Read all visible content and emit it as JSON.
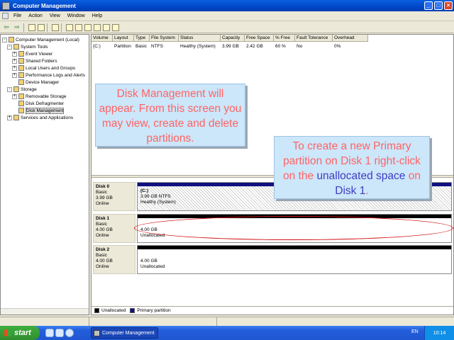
{
  "window": {
    "title": "Computer Management"
  },
  "menu": [
    "File",
    "Action",
    "View",
    "Window",
    "Help"
  ],
  "tree": [
    {
      "label": "Computer Management (Local)",
      "level": 0,
      "expander": "-"
    },
    {
      "label": "System Tools",
      "level": 1,
      "expander": "-"
    },
    {
      "label": "Event Viewer",
      "level": 2,
      "expander": "+"
    },
    {
      "label": "Shared Folders",
      "level": 2,
      "expander": "+"
    },
    {
      "label": "Local Users and Groups",
      "level": 2,
      "expander": "+"
    },
    {
      "label": "Performance Logs and Alerts",
      "level": 2,
      "expander": "+"
    },
    {
      "label": "Device Manager",
      "level": 2,
      "expander": ""
    },
    {
      "label": "Storage",
      "level": 1,
      "expander": "-"
    },
    {
      "label": "Removable Storage",
      "level": 2,
      "expander": "+"
    },
    {
      "label": "Disk Defragmenter",
      "level": 2,
      "expander": ""
    },
    {
      "label": "Disk Management",
      "level": 2,
      "expander": "",
      "selected": true
    },
    {
      "label": "Services and Applications",
      "level": 1,
      "expander": "+"
    }
  ],
  "volume_table": {
    "columns": [
      "Volume",
      "Layout",
      "Type",
      "File System",
      "Status",
      "Capacity",
      "Free Space",
      "% Free",
      "Fault Tolerance",
      "Overhead"
    ],
    "rows": [
      [
        "(C:)",
        "Partition",
        "Basic",
        "NTFS",
        "Healthy (System)",
        "3.99 GB",
        "2.42 GB",
        "60 %",
        "No",
        "0%"
      ]
    ]
  },
  "disks": [
    {
      "name": "Disk 0",
      "type": "Basic",
      "size": "3.99 GB",
      "state": "Online",
      "part_title": "(C:)",
      "part_size": "3.99 GB NTFS",
      "part_status": "Healthy (System)"
    },
    {
      "name": "Disk 1",
      "type": "Basic",
      "size": "4.00 GB",
      "state": "Online",
      "part_title": "",
      "part_size": "4.00 GB",
      "part_status": "Unallocated"
    },
    {
      "name": "Disk 2",
      "type": "Basic",
      "size": "4.00 GB",
      "state": "Online",
      "part_title": "",
      "part_size": "4.00 GB",
      "part_status": "Unallocated"
    }
  ],
  "legend": [
    {
      "label": "Unallocated",
      "color": "#000000"
    },
    {
      "label": "Primary partition",
      "color": "#101080"
    }
  ],
  "callouts": {
    "one": "Disk Management will appear. From this screen you may view, create and delete partitions.",
    "two_a": "To create a new Primary partition on Disk 1 right-click on the ",
    "two_b": "unallocated",
    "two_c": " space",
    "two_d": " on ",
    "two_e": "Disk 1",
    "two_f": "."
  },
  "taskbar": {
    "start": "start",
    "task": "Computer Management",
    "lang": "EN",
    "clock": "10:14"
  },
  "colors": {
    "callout_text": "#ff6464",
    "callout_highlight": "#3d3dc4",
    "callout_bg": "#cce6fa"
  }
}
